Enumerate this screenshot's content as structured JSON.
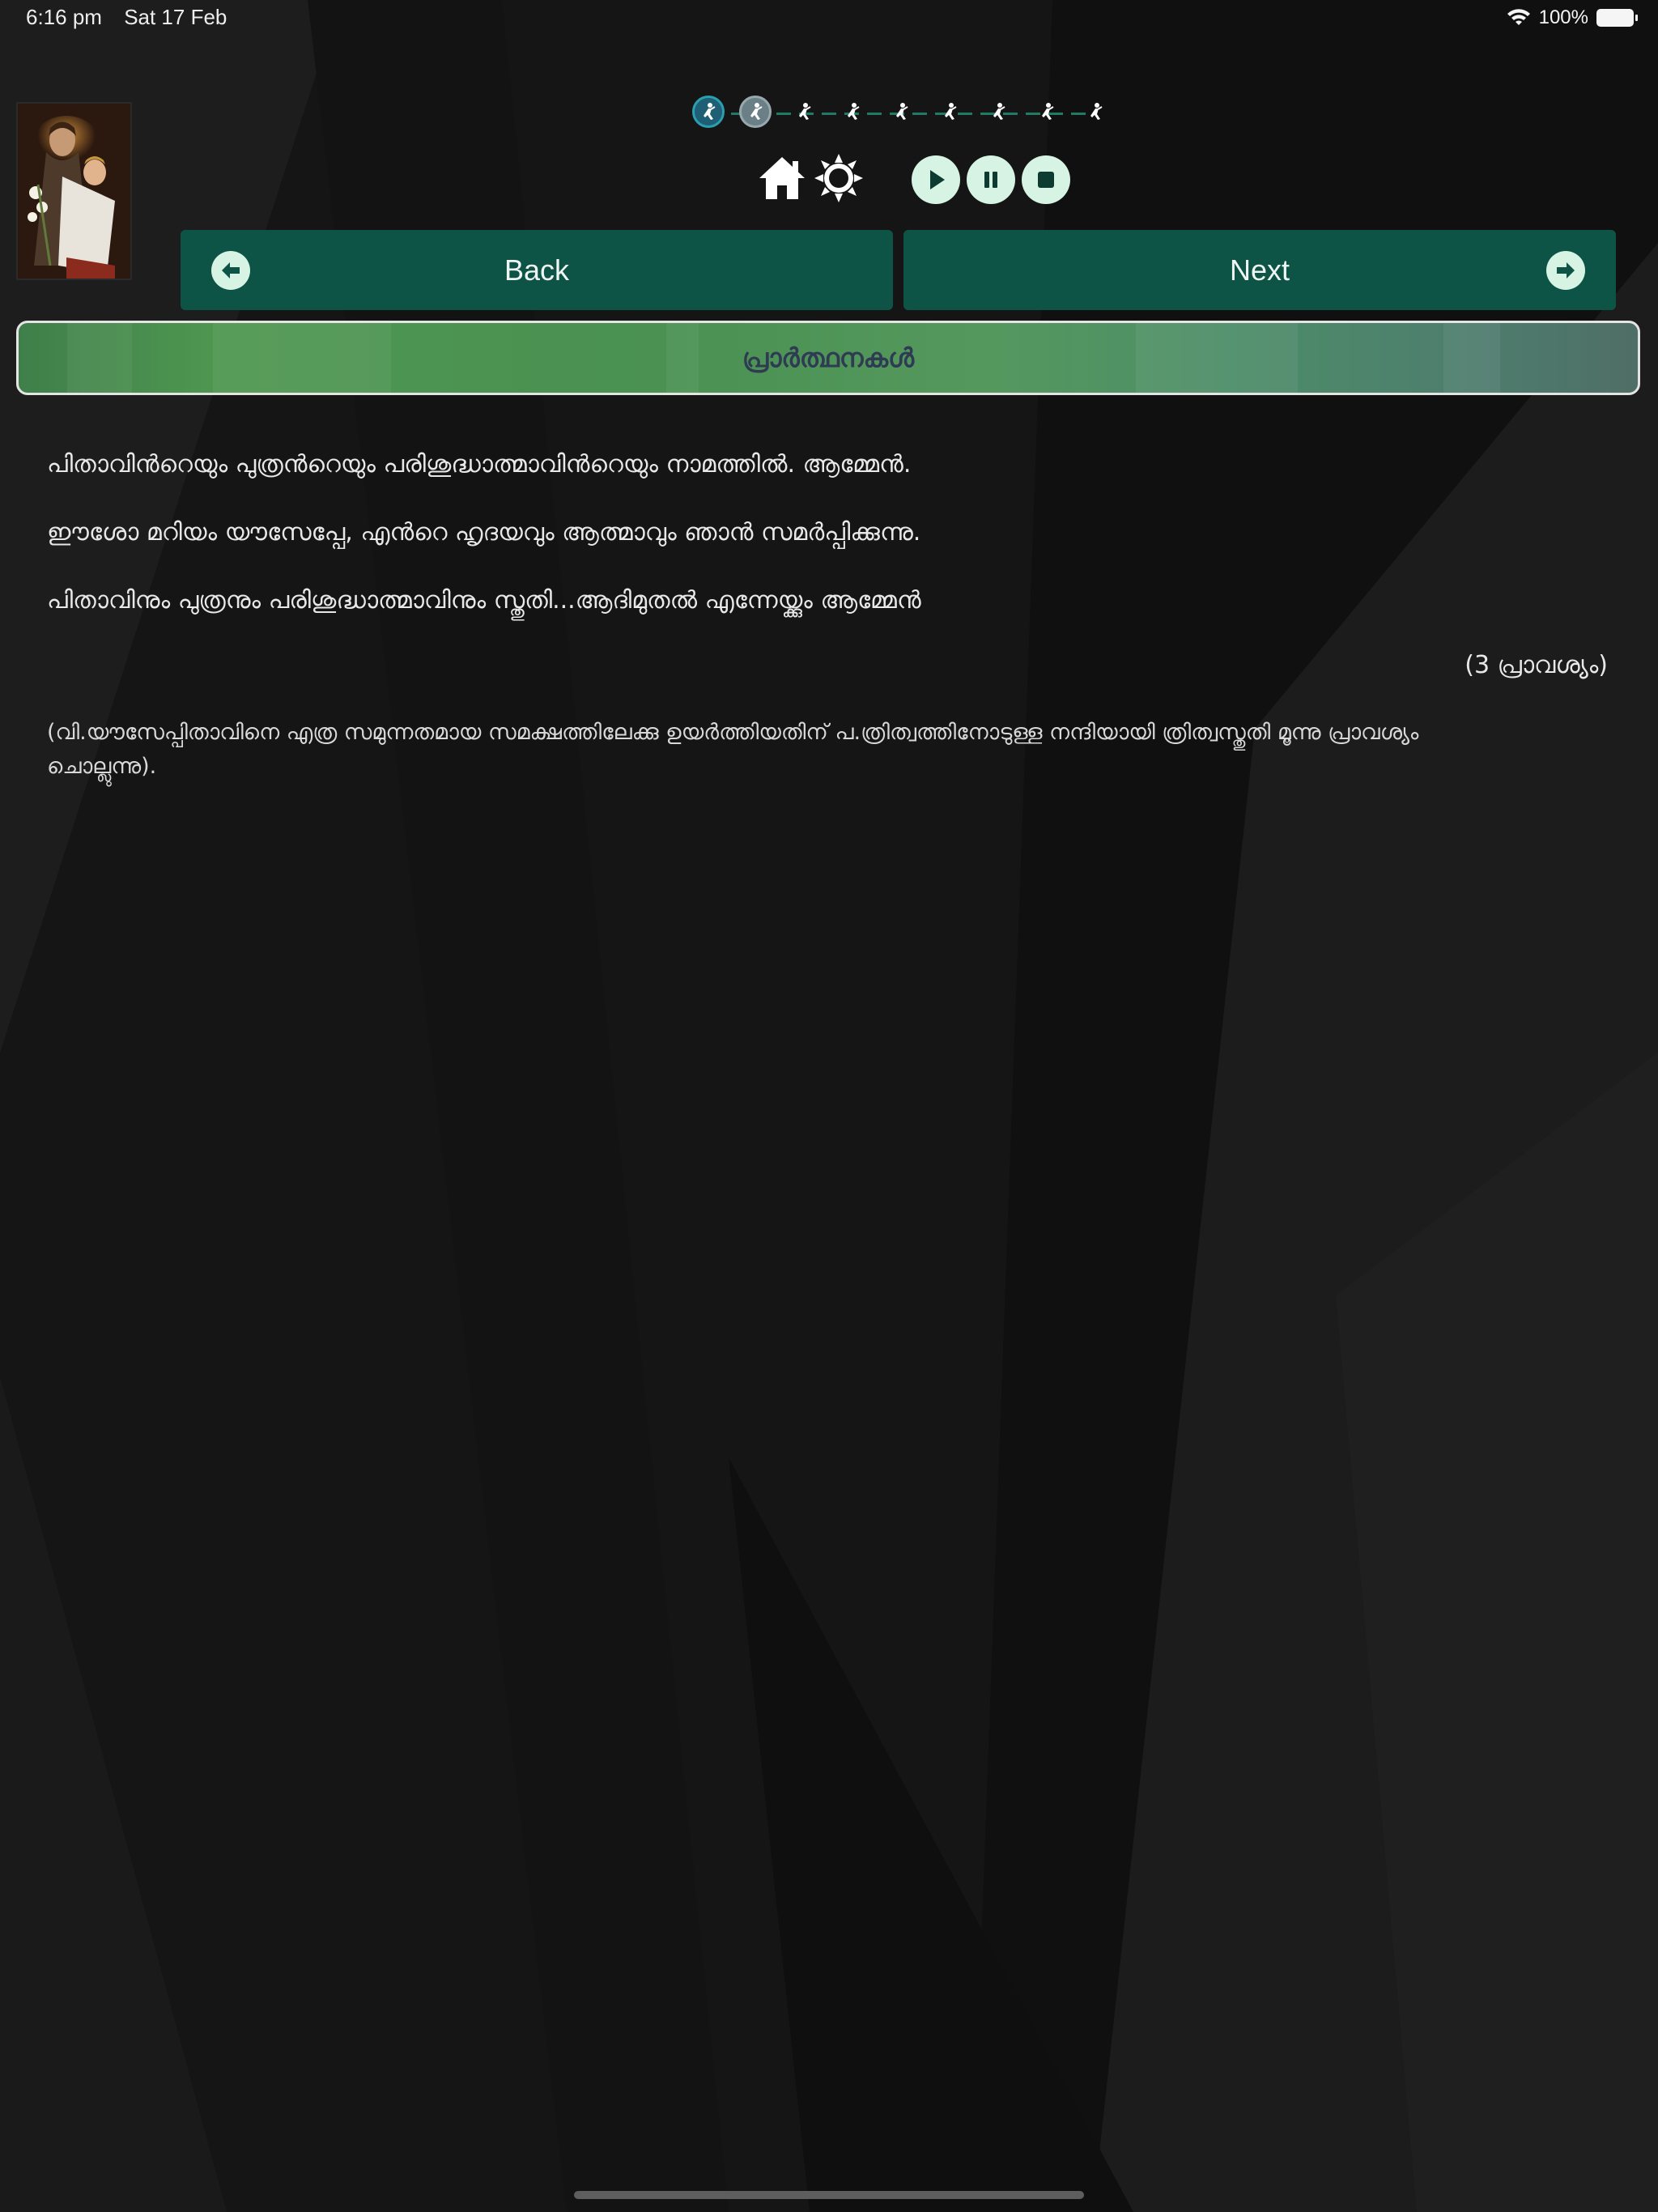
{
  "status_bar": {
    "time": "6:16 pm",
    "date": "Sat 17 Feb",
    "battery": "100%"
  },
  "progress": {
    "total_steps": 9,
    "current_step": 1,
    "completed_steps": 2,
    "icon": "kneeling-person-icon"
  },
  "controls": {
    "home_icon": "home-icon",
    "brightness_icon": "brightness-icon",
    "play_icon": "play-icon",
    "pause_icon": "pause-icon",
    "stop_icon": "stop-icon"
  },
  "nav": {
    "back_label": "Back",
    "next_label": "Next"
  },
  "section": {
    "title": "പ്രാർത്ഥനകൾ"
  },
  "prayers": [
    "പിതാവിൻറെയും പുത്രൻറെയും പരിശുദ്ധാത്മാവിൻറെയും നാമത്തിൽ. ആമ്മേൻ.",
    "ഈശോ മറിയം യൗസേപ്പേ,  എൻറെ ഹൃദയവും ആത്മാവും ഞാൻ സമർപ്പിക്കുന്നു.",
    "പിതാവിനും പുത്രനും പരിശുദ്ധാത്മാവിനും സ്തുതി...ആദിമുതൽ എന്നേയ്ക്കും ആമ്മേൻ"
  ],
  "repeat_note": "(3 പ്രാവശ്യം)",
  "footnote": "(വി.യൗസേപ്പിതാവിനെ എത്ര സമുന്നതമായ സമക്ഷത്തിലേക്കു ഉയർത്തിയതിന് പ.ത്രിത്വത്തിനോടുള്ള നന്ദിയായി ത്രിത്വസ്തുതി മൂന്നു പ്രാവശ്യം ചൊല്ലുന്നു).",
  "colors": {
    "background": "#141414",
    "button_green": "#0e5446",
    "icon_mint": "#d6f3e4",
    "header_text": "#2e3b52"
  }
}
